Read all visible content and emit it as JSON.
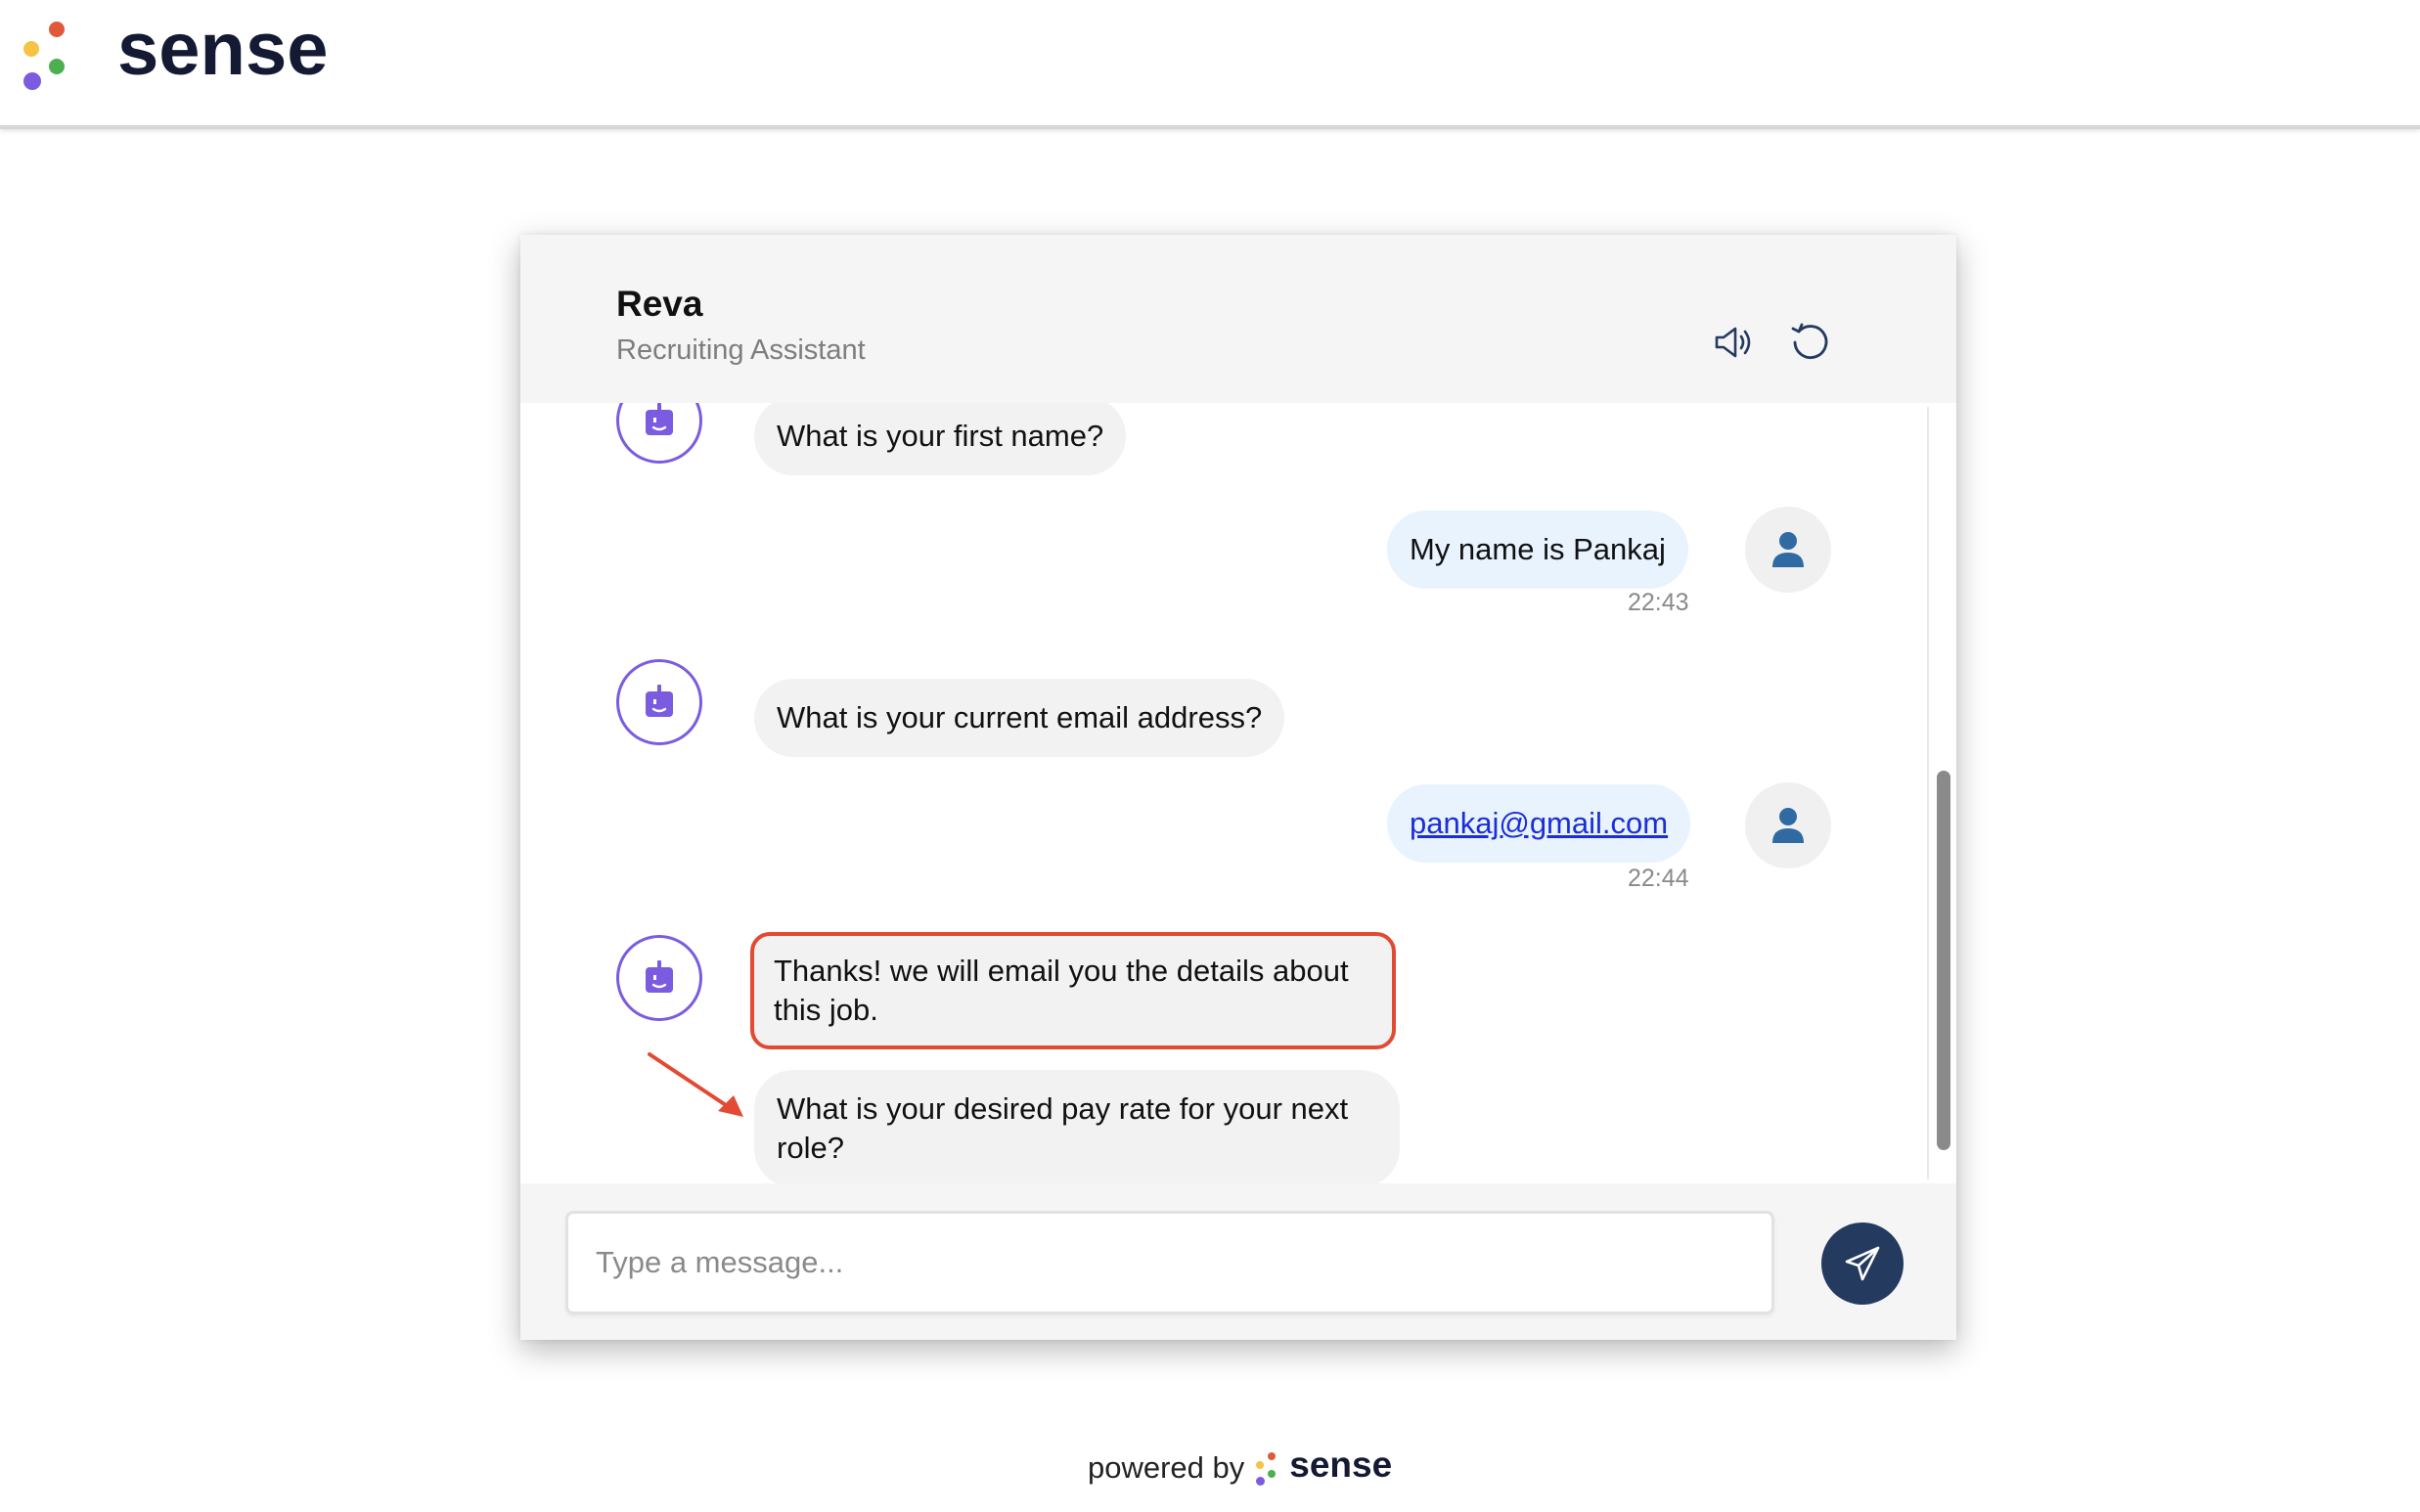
{
  "brand": {
    "name": "sense",
    "dot_colors": [
      "#e05a3a",
      "#f6c343",
      "#4caf50",
      "#7b5be0"
    ]
  },
  "chat": {
    "assistant_name": "Reva",
    "assistant_role": "Recruiting Assistant",
    "messages": [
      {
        "sender": "bot",
        "text": "What is your first name?"
      },
      {
        "sender": "user",
        "text": "My name is Pankaj",
        "time": "22:43"
      },
      {
        "sender": "bot",
        "text": "What is your current email address?"
      },
      {
        "sender": "user",
        "text": "pankaj@gmail.com",
        "time": "22:44"
      },
      {
        "sender": "bot",
        "text": "Thanks! we will email you the details about this job.",
        "highlighted": true
      },
      {
        "sender": "bot",
        "text": "What is your desired pay rate for your next role?"
      }
    ],
    "input_placeholder": "Type a message..."
  },
  "footer": {
    "powered_by": "powered by",
    "brand": "sense"
  },
  "colors": {
    "accent_purple": "#7b5be0",
    "send_button": "#243a5e",
    "user_bubble": "#e8f3fe",
    "bot_bubble": "#f2f2f2",
    "highlight": "#e24a33",
    "user_icon": "#2f6aa3"
  },
  "icons": {
    "speaker": "speaker-icon",
    "refresh": "refresh-icon",
    "bot": "bot-icon",
    "user": "user-icon",
    "send": "send-icon"
  }
}
